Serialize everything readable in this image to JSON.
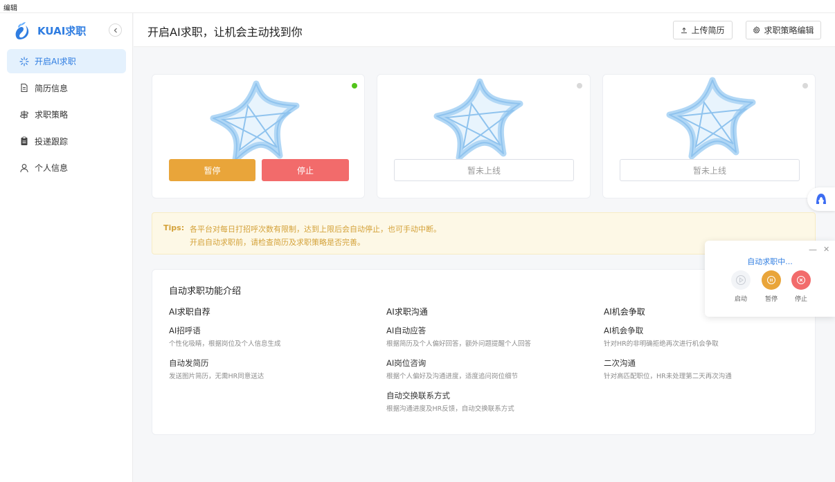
{
  "menubar": {
    "label": "编辑"
  },
  "brand": {
    "name": "KUAI求职"
  },
  "nav": {
    "items": [
      {
        "label": "开启AI求职",
        "icon": "sparkle-icon",
        "active": true
      },
      {
        "label": "简历信息",
        "icon": "document-icon"
      },
      {
        "label": "求职策略",
        "icon": "signpost-icon"
      },
      {
        "label": "投递跟踪",
        "icon": "clipboard-icon"
      },
      {
        "label": "个人信息",
        "icon": "user-icon"
      }
    ]
  },
  "header": {
    "title": "开启AI求职，让机会主动找到你",
    "upload_label": "上传简历",
    "strategy_label": "求职策略编辑"
  },
  "cards": [
    {
      "status": "active",
      "status_color": "#52c41a",
      "pause_label": "暂停",
      "stop_label": "停止"
    },
    {
      "status": "inactive",
      "status_color": "#d9d9d9",
      "offline_label": "暂未上线"
    },
    {
      "status": "inactive",
      "status_color": "#d9d9d9",
      "offline_label": "暂未上线"
    }
  ],
  "tips": {
    "label": "Tips:",
    "line1": "各平台对每日打招呼次数有限制，达到上限后会自动停止，也可手动中断。",
    "line2": "开启自动求职前，请检查简历及求职策略是否完善。"
  },
  "intro": {
    "title": "自动求职功能介绍",
    "columns": [
      {
        "title": "AI求职自荐",
        "features": [
          {
            "name": "AI招呼语",
            "desc": "个性化吸睛，根据岗位及个人信息生成"
          },
          {
            "name": "自动发简历",
            "desc": "发送图片简历，无需HR同意送达"
          }
        ]
      },
      {
        "title": "AI求职沟通",
        "features": [
          {
            "name": "AI自动应答",
            "desc": "根据简历及个人偏好回答，额外问题提醒个人回答"
          },
          {
            "name": "AI岗位咨询",
            "desc": "根据个人偏好及沟通进度，适度追问岗位细节"
          },
          {
            "name": "自动交换联系方式",
            "desc": "根据沟通进度及HR反馈，自动交换联系方式"
          }
        ]
      },
      {
        "title": "AI机会争取",
        "features": [
          {
            "name": "AI机会争取",
            "desc": "针对HR的非明确拒绝再次进行机会争取"
          },
          {
            "name": "二次沟通",
            "desc": "针对高匹配职位，HR未处理第二天再次沟通"
          }
        ]
      }
    ]
  },
  "panel": {
    "title": "自动求职中...",
    "start_label": "启动",
    "pause_label": "暂停",
    "stop_label": "停止"
  },
  "colors": {
    "accent": "#2f7de1",
    "pause": "#e9a53a",
    "stop": "#f26b6b",
    "active_dot": "#52c41a",
    "tips_text": "#d4a23a"
  }
}
